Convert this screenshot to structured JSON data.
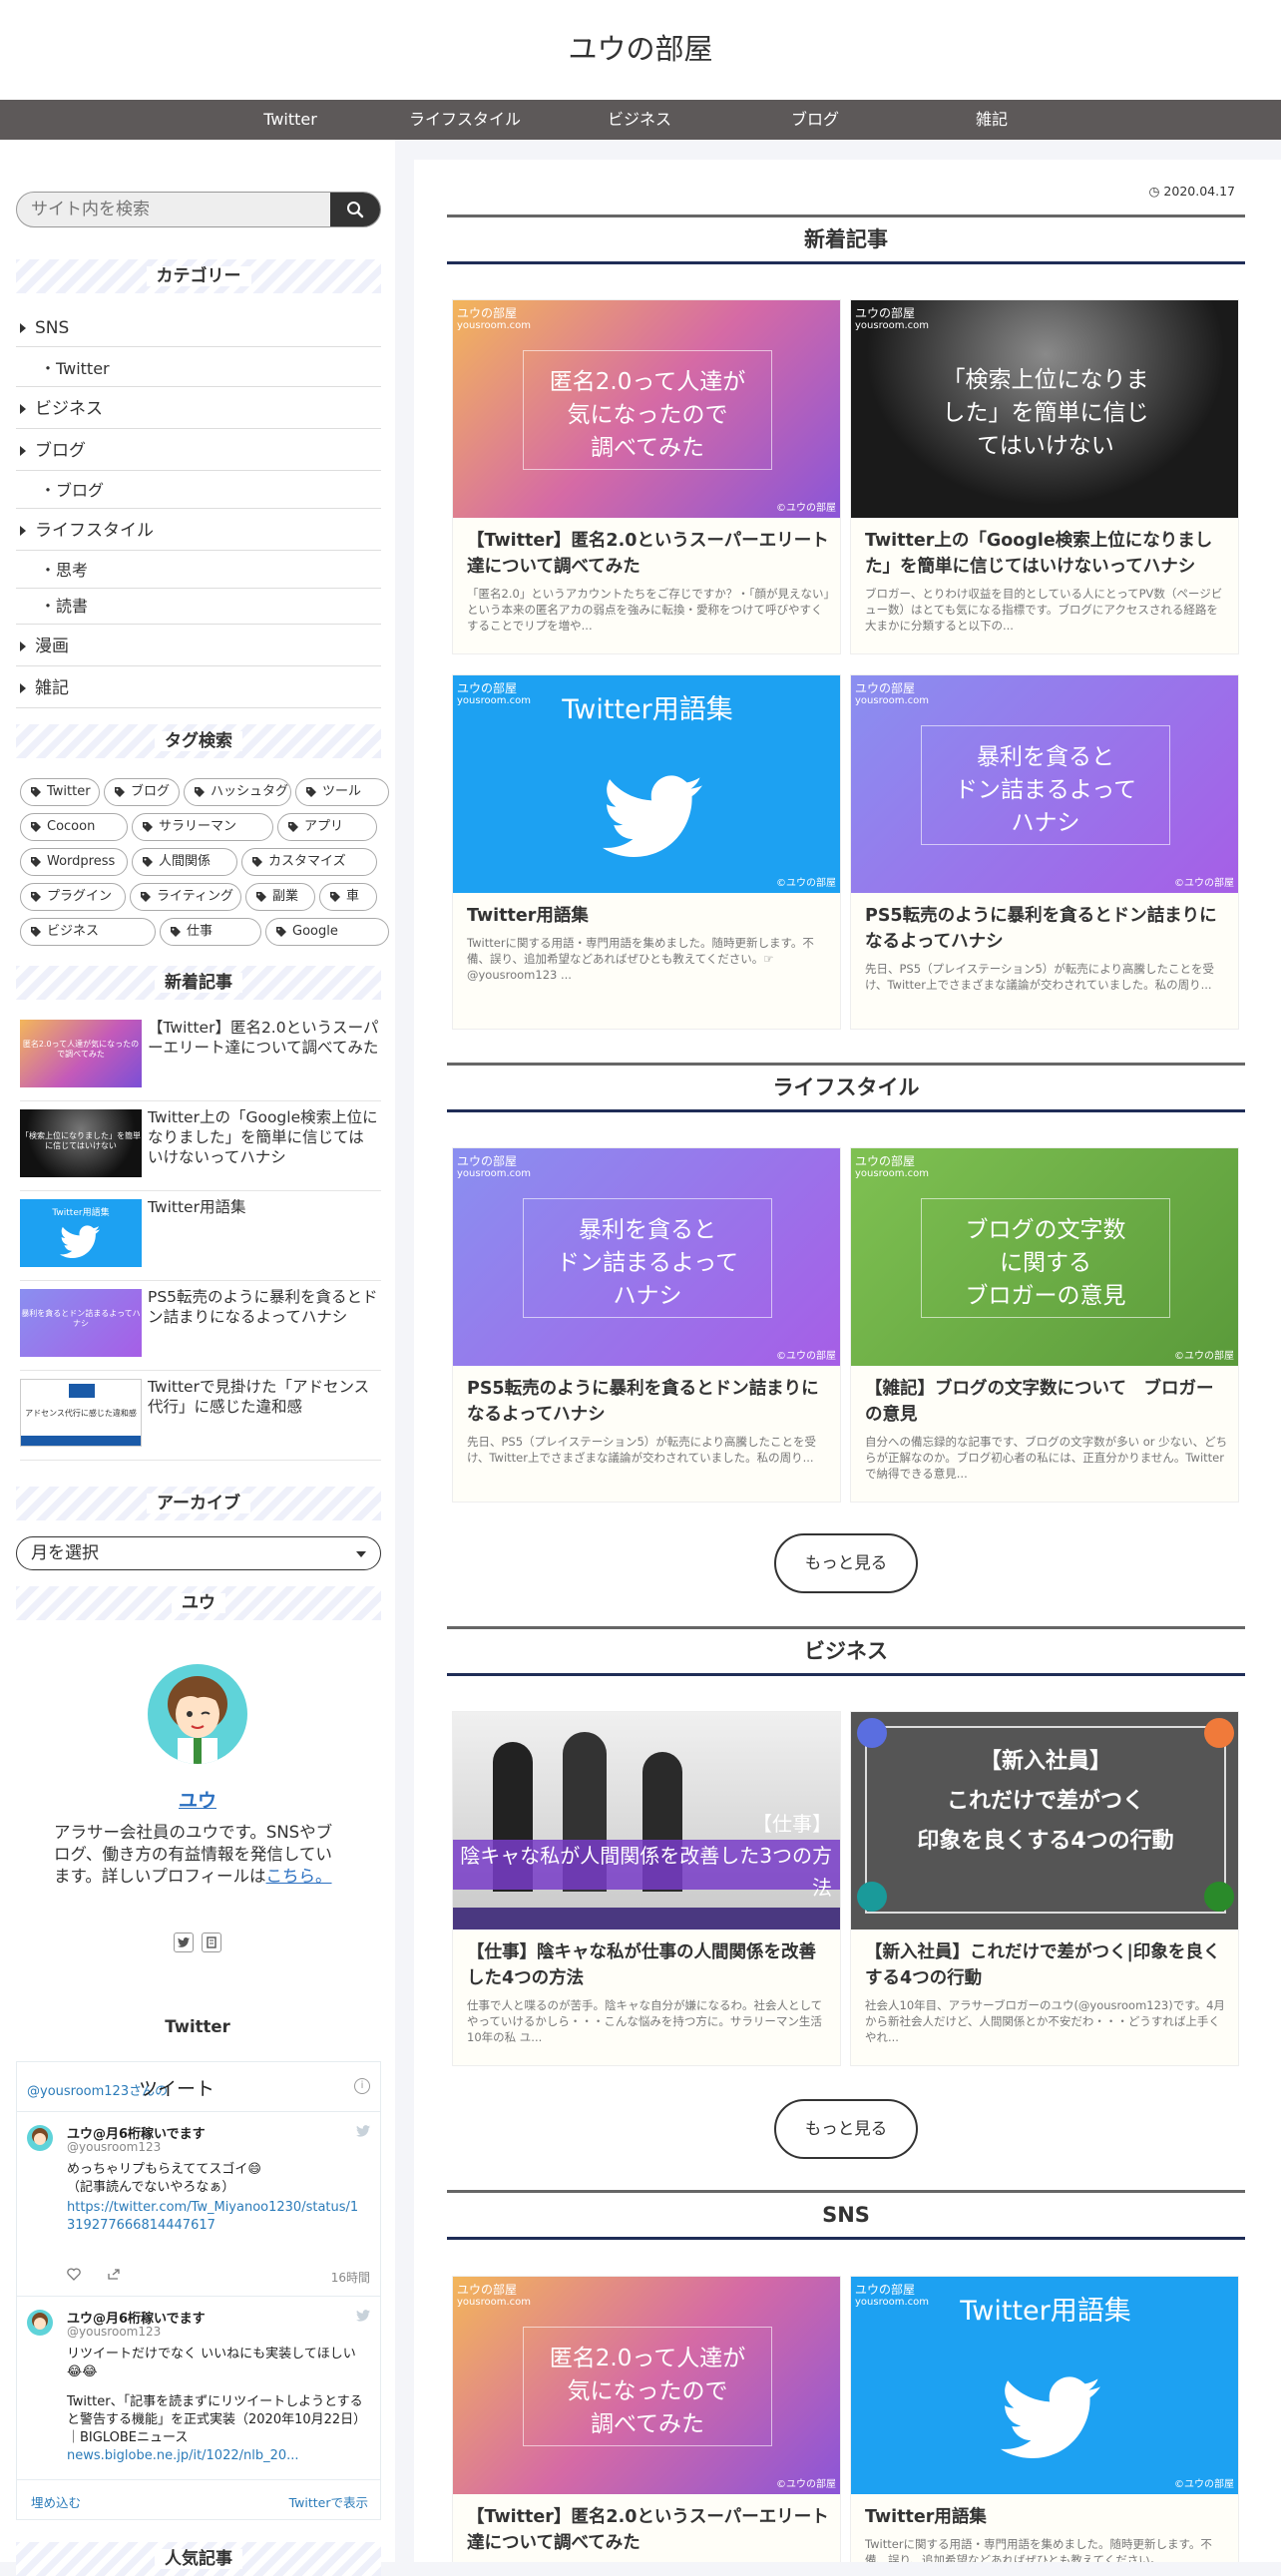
{
  "site": {
    "title": "ユウの部屋"
  },
  "nav": [
    "Twitter",
    "ライフスタイル",
    "ビジネス",
    "ブログ",
    "雑記"
  ],
  "search": {
    "placeholder": "サイト内を検索"
  },
  "categories": {
    "title": "カテゴリー",
    "items": [
      {
        "label": "SNS",
        "sub": false
      },
      {
        "label": "・Twitter",
        "sub": true
      },
      {
        "label": "ビジネス",
        "sub": false
      },
      {
        "label": "ブログ",
        "sub": false
      },
      {
        "label": "・ブログ",
        "sub": true
      },
      {
        "label": "ライフスタイル",
        "sub": false
      },
      {
        "label": "・思考",
        "sub": true
      },
      {
        "label": "・読書",
        "sub": true
      },
      {
        "label": "漫画",
        "sub": false
      },
      {
        "label": "雑記",
        "sub": false
      }
    ]
  },
  "tags": {
    "title": "タグ検索",
    "items": [
      "Twitter",
      "ブログ",
      "ハッシュタグ",
      "ツール",
      "Cocoon",
      "サラリーマン",
      "アプリ",
      "Wordpress",
      "人間関係",
      "カスタマイズ",
      "プラグイン",
      "ライティング",
      "副業",
      "車",
      "ビジネス",
      "仕事",
      "Google"
    ]
  },
  "side_new": {
    "title": "新着記事",
    "items": [
      {
        "title": "【Twitter】匿名2.0というスーパーエリート達について調べてみた",
        "thumb": "匿名2.0って人達が気になったので調べてみた"
      },
      {
        "title": "Twitter上の「Google検索上位になりました」を簡単に信じてはいけないってハナシ",
        "thumb": "「検索上位になりました」を簡単に信じてはいけない"
      },
      {
        "title": "Twitter用語集",
        "thumb": "Twitter用語集"
      },
      {
        "title": "PS5転売のように暴利を貪るとドン詰まりになるよってハナシ",
        "thumb": "暴利を貪るとドン詰まるよってハナシ"
      },
      {
        "title": "Twitterで見掛けた「アドセンス代行」に感じた違和感",
        "thumb": "アドセンス代行に感じた違和感"
      }
    ]
  },
  "archive": {
    "title": "アーカイブ",
    "select": "月を選択"
  },
  "profile": {
    "title": "ユウ",
    "name": "ユウ",
    "desc": "アラサー会社員のユウです。SNSやブログ、働き方の有益情報を発信しています。詳しいプロフィールは",
    "link": "こちら。"
  },
  "twitter_widget": {
    "title": "Twitter",
    "header_handle": "@yousroom123さんの",
    "header_label": "ツイート",
    "tweets": [
      {
        "name": "ユウ@月6桁稼いでます",
        "handle": "@yousroom123",
        "text": "めっちゃリプもらえててスゴイ😄\n（記事読んでないやろなぁ）",
        "link": "https://twitter.com/Tw_Miyanoo1230/status/1319277666814447617",
        "time": "16時間"
      },
      {
        "name": "ユウ@月6桁稼いでます",
        "handle": "@yousroom123",
        "text": "リツイートだけでなく いいねにも実装してほしい😂😂",
        "text2": "Twitter、「記事を読まずにリツイートしようとすると警告する機能」を正式実装（2020年10月22日）｜BIGLOBEニュース",
        "link": "news.biglobe.ne.jp/it/1022/nlb_20..."
      }
    ],
    "embed": "埋め込む",
    "view": "Twitterで表示"
  },
  "popular": {
    "title": "人気記事"
  },
  "main": {
    "date": "2020.04.17",
    "sections": [
      {
        "title": "新着記事",
        "cards": [
          {
            "title": "【Twitter】匿名2.0というスーパーエリート達について調べてみた",
            "snippet": "「匿名2.0」というアカウントたちをご存じですか？・「顔が見えない」という本来の匿名アカの弱点を強みに転換・愛称をつけて呼びやすくすることでリプを増や...",
            "thumb": "匿名2.0って人達が\n気になったので\n調べてみた"
          },
          {
            "title": "Twitter上の「Google検索上位になりました」を簡単に信じてはいけないってハナシ",
            "snippet": "ブロガー、とりわけ収益を目的としている人にとってPV数（ページビュー数）はとても気になる指標です。ブログにアクセスされる経路を大まかに分類すると以下の...",
            "thumb": "「検索上位になりま\nした」を簡単に信じ\nてはいけない"
          },
          {
            "title": "Twitter用語集",
            "snippet": "Twitterに関する用語・専門用語を集めました。随時更新します。不備、誤り、追加希望などあればぜひとも教えてください。☞ @yousroom123 ...",
            "thumb": "Twitter用語集"
          },
          {
            "title": "PS5転売のように暴利を貪るとドン詰まりになるよってハナシ",
            "snippet": "先日、PS5（プレイステーション5）が転売により高騰したことを受け、Twitter上でさまざまな議論が交わされていました。私の周り...",
            "thumb": "暴利を貪ると\nドン詰まるよって\nハナシ"
          }
        ]
      },
      {
        "title": "ライフスタイル",
        "cards": [
          {
            "title": "PS5転売のように暴利を貪るとドン詰まりになるよってハナシ",
            "snippet": "先日、PS5（プレイステーション5）が転売により高騰したことを受け、Twitter上でさまざまな議論が交わされていました。私の周り...",
            "thumb": "暴利を貪ると\nドン詰まるよって\nハナシ"
          },
          {
            "title": "【雑記】ブログの文字数について　ブロガーの意見",
            "snippet": "自分への備忘録的な記事です、ブログの文字数が多い or 少ない、どちらが正解なのか。ブログ初心者の私には、正直分かりません。Twitterで納得できる意見...",
            "thumb": "ブログの文字数\nに関する\nブロガーの意見"
          }
        ],
        "more": "もっと見る"
      },
      {
        "title": "ビジネス",
        "cards": [
          {
            "title": "【仕事】陰キャな私が仕事の人間関係を改善した4つの方法",
            "snippet": "仕事で人と喋るのが苦手。陰キャな自分が嫌になるわ。社会人としてやっていけるかしら・・・こんな悩みを持つ方に。サラリーマン生活10年の私 ユ...",
            "thumb": "【仕事】\n陰キャな私が人間関係を改善した3つの方法"
          },
          {
            "title": "【新入社員】これだけで差がつく|印象を良くする4つの行動",
            "snippet": "社会人10年目、アラサーブロガーのユウ(@yousroom123)です。4月から新社会人だけど、人間関係とか不安だわ・・・どうすれば上手くやれ...",
            "thumb": "【新入社員】\nこれだけで差がつく\n印象を良くする4つの行動"
          }
        ],
        "more": "もっと見る"
      },
      {
        "title": "SNS",
        "cards": [
          {
            "title": "【Twitter】匿名2.0というスーパーエリート達について調べてみた",
            "snippet": "",
            "thumb": "匿名2.0って人達が\n気になったので\n調べてみた"
          },
          {
            "title": "Twitter用語集",
            "snippet": "Twitterに関する用語・専門用語を集めました。随時更新します。不備、誤り、追加希望などあればぜひとも教えてください。",
            "thumb": "Twitter用語集"
          }
        ]
      }
    ],
    "watermark": "ユウの部屋",
    "watermark_url": "yousroom.com",
    "copyright": "©ユウの部屋"
  }
}
